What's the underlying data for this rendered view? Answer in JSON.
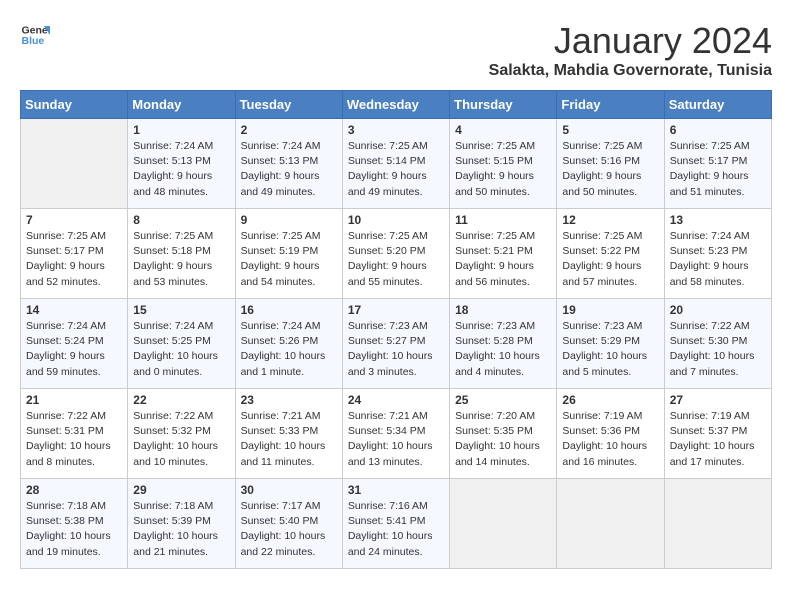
{
  "logo": {
    "line1": "General",
    "line2": "Blue"
  },
  "title": "January 2024",
  "location": "Salakta, Mahdia Governorate, Tunisia",
  "days_of_week": [
    "Sunday",
    "Monday",
    "Tuesday",
    "Wednesday",
    "Thursday",
    "Friday",
    "Saturday"
  ],
  "weeks": [
    [
      {
        "date": "",
        "sunrise": "",
        "sunset": "",
        "daylight": ""
      },
      {
        "date": "1",
        "sunrise": "Sunrise: 7:24 AM",
        "sunset": "Sunset: 5:13 PM",
        "daylight": "Daylight: 9 hours and 48 minutes."
      },
      {
        "date": "2",
        "sunrise": "Sunrise: 7:24 AM",
        "sunset": "Sunset: 5:13 PM",
        "daylight": "Daylight: 9 hours and 49 minutes."
      },
      {
        "date": "3",
        "sunrise": "Sunrise: 7:25 AM",
        "sunset": "Sunset: 5:14 PM",
        "daylight": "Daylight: 9 hours and 49 minutes."
      },
      {
        "date": "4",
        "sunrise": "Sunrise: 7:25 AM",
        "sunset": "Sunset: 5:15 PM",
        "daylight": "Daylight: 9 hours and 50 minutes."
      },
      {
        "date": "5",
        "sunrise": "Sunrise: 7:25 AM",
        "sunset": "Sunset: 5:16 PM",
        "daylight": "Daylight: 9 hours and 50 minutes."
      },
      {
        "date": "6",
        "sunrise": "Sunrise: 7:25 AM",
        "sunset": "Sunset: 5:17 PM",
        "daylight": "Daylight: 9 hours and 51 minutes."
      }
    ],
    [
      {
        "date": "7",
        "sunrise": "Sunrise: 7:25 AM",
        "sunset": "Sunset: 5:17 PM",
        "daylight": "Daylight: 9 hours and 52 minutes."
      },
      {
        "date": "8",
        "sunrise": "Sunrise: 7:25 AM",
        "sunset": "Sunset: 5:18 PM",
        "daylight": "Daylight: 9 hours and 53 minutes."
      },
      {
        "date": "9",
        "sunrise": "Sunrise: 7:25 AM",
        "sunset": "Sunset: 5:19 PM",
        "daylight": "Daylight: 9 hours and 54 minutes."
      },
      {
        "date": "10",
        "sunrise": "Sunrise: 7:25 AM",
        "sunset": "Sunset: 5:20 PM",
        "daylight": "Daylight: 9 hours and 55 minutes."
      },
      {
        "date": "11",
        "sunrise": "Sunrise: 7:25 AM",
        "sunset": "Sunset: 5:21 PM",
        "daylight": "Daylight: 9 hours and 56 minutes."
      },
      {
        "date": "12",
        "sunrise": "Sunrise: 7:25 AM",
        "sunset": "Sunset: 5:22 PM",
        "daylight": "Daylight: 9 hours and 57 minutes."
      },
      {
        "date": "13",
        "sunrise": "Sunrise: 7:24 AM",
        "sunset": "Sunset: 5:23 PM",
        "daylight": "Daylight: 9 hours and 58 minutes."
      }
    ],
    [
      {
        "date": "14",
        "sunrise": "Sunrise: 7:24 AM",
        "sunset": "Sunset: 5:24 PM",
        "daylight": "Daylight: 9 hours and 59 minutes."
      },
      {
        "date": "15",
        "sunrise": "Sunrise: 7:24 AM",
        "sunset": "Sunset: 5:25 PM",
        "daylight": "Daylight: 10 hours and 0 minutes."
      },
      {
        "date": "16",
        "sunrise": "Sunrise: 7:24 AM",
        "sunset": "Sunset: 5:26 PM",
        "daylight": "Daylight: 10 hours and 1 minute."
      },
      {
        "date": "17",
        "sunrise": "Sunrise: 7:23 AM",
        "sunset": "Sunset: 5:27 PM",
        "daylight": "Daylight: 10 hours and 3 minutes."
      },
      {
        "date": "18",
        "sunrise": "Sunrise: 7:23 AM",
        "sunset": "Sunset: 5:28 PM",
        "daylight": "Daylight: 10 hours and 4 minutes."
      },
      {
        "date": "19",
        "sunrise": "Sunrise: 7:23 AM",
        "sunset": "Sunset: 5:29 PM",
        "daylight": "Daylight: 10 hours and 5 minutes."
      },
      {
        "date": "20",
        "sunrise": "Sunrise: 7:22 AM",
        "sunset": "Sunset: 5:30 PM",
        "daylight": "Daylight: 10 hours and 7 minutes."
      }
    ],
    [
      {
        "date": "21",
        "sunrise": "Sunrise: 7:22 AM",
        "sunset": "Sunset: 5:31 PM",
        "daylight": "Daylight: 10 hours and 8 minutes."
      },
      {
        "date": "22",
        "sunrise": "Sunrise: 7:22 AM",
        "sunset": "Sunset: 5:32 PM",
        "daylight": "Daylight: 10 hours and 10 minutes."
      },
      {
        "date": "23",
        "sunrise": "Sunrise: 7:21 AM",
        "sunset": "Sunset: 5:33 PM",
        "daylight": "Daylight: 10 hours and 11 minutes."
      },
      {
        "date": "24",
        "sunrise": "Sunrise: 7:21 AM",
        "sunset": "Sunset: 5:34 PM",
        "daylight": "Daylight: 10 hours and 13 minutes."
      },
      {
        "date": "25",
        "sunrise": "Sunrise: 7:20 AM",
        "sunset": "Sunset: 5:35 PM",
        "daylight": "Daylight: 10 hours and 14 minutes."
      },
      {
        "date": "26",
        "sunrise": "Sunrise: 7:19 AM",
        "sunset": "Sunset: 5:36 PM",
        "daylight": "Daylight: 10 hours and 16 minutes."
      },
      {
        "date": "27",
        "sunrise": "Sunrise: 7:19 AM",
        "sunset": "Sunset: 5:37 PM",
        "daylight": "Daylight: 10 hours and 17 minutes."
      }
    ],
    [
      {
        "date": "28",
        "sunrise": "Sunrise: 7:18 AM",
        "sunset": "Sunset: 5:38 PM",
        "daylight": "Daylight: 10 hours and 19 minutes."
      },
      {
        "date": "29",
        "sunrise": "Sunrise: 7:18 AM",
        "sunset": "Sunset: 5:39 PM",
        "daylight": "Daylight: 10 hours and 21 minutes."
      },
      {
        "date": "30",
        "sunrise": "Sunrise: 7:17 AM",
        "sunset": "Sunset: 5:40 PM",
        "daylight": "Daylight: 10 hours and 22 minutes."
      },
      {
        "date": "31",
        "sunrise": "Sunrise: 7:16 AM",
        "sunset": "Sunset: 5:41 PM",
        "daylight": "Daylight: 10 hours and 24 minutes."
      },
      {
        "date": "",
        "sunrise": "",
        "sunset": "",
        "daylight": ""
      },
      {
        "date": "",
        "sunrise": "",
        "sunset": "",
        "daylight": ""
      },
      {
        "date": "",
        "sunrise": "",
        "sunset": "",
        "daylight": ""
      }
    ]
  ]
}
